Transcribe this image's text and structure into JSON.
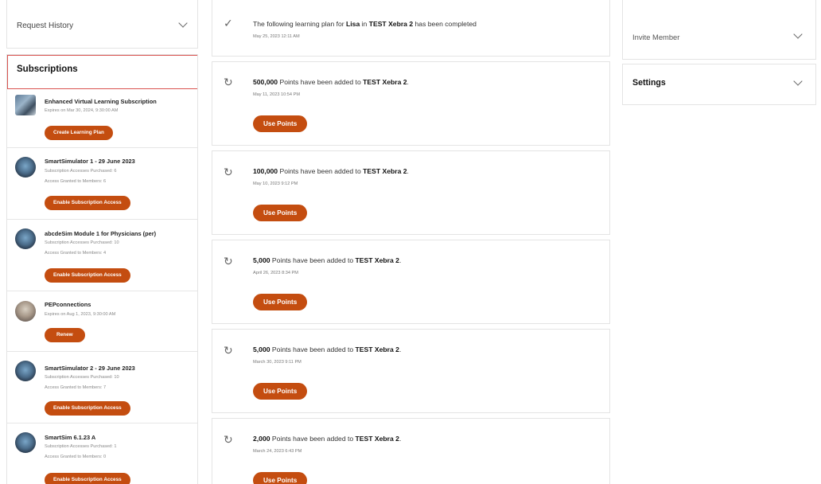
{
  "left": {
    "request_history": "Request History",
    "subscriptions_title": "Subscriptions",
    "items": [
      {
        "name": "Enhanced Virtual Learning Subscription",
        "meta1": "Expires on Mar 30, 2024, 9:30:00 AM",
        "meta2": "",
        "button": "Create Learning Plan"
      },
      {
        "name": "SmartSimulator 1 - 29 June 2023",
        "meta1": "Subscription Accesses Purchased: 6",
        "meta2": "Access Granted to Members: 6",
        "button": "Enable Subscription Access"
      },
      {
        "name": "abcdeSim Module 1 for Physicians (per)",
        "meta1": "Subscription Accesses Purchased: 10",
        "meta2": "Access Granted to Members: 4",
        "button": "Enable Subscription Access"
      },
      {
        "name": "PEPconnections",
        "meta1": "Expires on Aug 1, 2023, 9:30:00 AM",
        "meta2": "",
        "button": "Renew"
      },
      {
        "name": "SmartSimulator 2 - 29 June 2023",
        "meta1": "Subscription Accesses Purchased: 10",
        "meta2": "Access Granted to Members: 7",
        "button": "Enable Subscription Access"
      },
      {
        "name": "SmartSim 6.1.23 A",
        "meta1": "Subscription Accesses Purchased: 1",
        "meta2": "Access Granted to Members: 0",
        "button": "Enable Subscription Access"
      }
    ]
  },
  "feed": {
    "items": [
      {
        "icon": "check-icon",
        "text_a": "The following learning plan for ",
        "bold_a": "Lisa",
        "text_b": " in ",
        "bold_b": "TEST Xebra 2",
        "text_c": " has been completed",
        "date": "May 25, 2023 12:11 AM",
        "button": ""
      },
      {
        "icon": "refresh-icon",
        "bold_a": "500,000",
        "text_a": " Points have been added to ",
        "bold_b": "TEST Xebra 2",
        "text_c": ".",
        "date": "May 11, 2023 10:54 PM",
        "button": "Use Points"
      },
      {
        "icon": "refresh-icon",
        "bold_a": "100,000",
        "text_a": " Points have been added to ",
        "bold_b": "TEST Xebra 2",
        "text_c": ".",
        "date": "May 10, 2023 9:12 PM",
        "button": "Use Points"
      },
      {
        "icon": "refresh-icon",
        "bold_a": "5,000",
        "text_a": " Points have been added to ",
        "bold_b": "TEST Xebra 2",
        "text_c": ".",
        "date": "April 26, 2023 8:34 PM",
        "button": "Use Points"
      },
      {
        "icon": "refresh-icon",
        "bold_a": "5,000",
        "text_a": " Points have been added to ",
        "bold_b": "TEST Xebra 2",
        "text_c": ".",
        "date": "March 30, 2023 9:11 PM",
        "button": "Use Points"
      },
      {
        "icon": "refresh-icon",
        "bold_a": "2,000",
        "text_a": " Points have been added to ",
        "bold_b": "TEST Xebra 2",
        "text_c": ".",
        "date": "March 24, 2023 6:43 PM",
        "button": "Use Points"
      }
    ]
  },
  "right": {
    "invite_member": "Invite Member",
    "settings": "Settings"
  },
  "colors": {
    "accent": "#c44d10",
    "highlight_border": "#d9534f"
  }
}
